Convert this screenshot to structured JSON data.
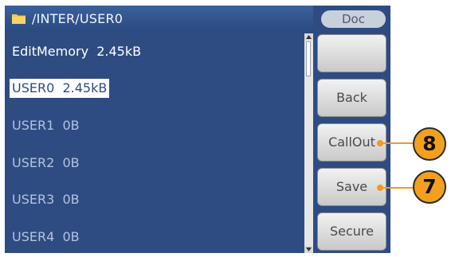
{
  "title_bar": {
    "path": "/INTER/USER0",
    "icon": "folder-icon"
  },
  "file_list": [
    {
      "name": "EditMemory",
      "size": "2.45kB",
      "state": "current"
    },
    {
      "name": "USER0",
      "size": "2.45kB",
      "state": "selected"
    },
    {
      "name": "USER1",
      "size": "0B",
      "state": "normal"
    },
    {
      "name": "USER2",
      "size": "0B",
      "state": "normal"
    },
    {
      "name": "USER3",
      "size": "0B",
      "state": "normal"
    },
    {
      "name": "USER4",
      "size": "0B",
      "state": "normal"
    }
  ],
  "softkeys": {
    "menu_title": "Doc",
    "keys": [
      {
        "label": ""
      },
      {
        "label": "Back"
      },
      {
        "label": "CallOut"
      },
      {
        "label": "Save"
      },
      {
        "label": "Secure"
      }
    ]
  },
  "callouts": [
    {
      "number": "8",
      "target": "CallOut"
    },
    {
      "number": "7",
      "target": "Save"
    }
  ],
  "colors": {
    "screen_bg": "#2e4c82",
    "selection_bg": "#ffffff",
    "callout_orange": "#f4a01f"
  }
}
